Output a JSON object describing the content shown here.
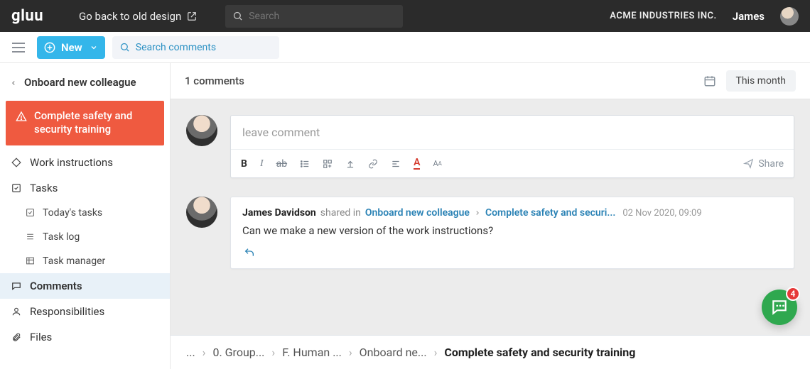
{
  "topbar": {
    "logo_text": "gluu",
    "back_link": "Go back to old design",
    "global_search_placeholder": "Search",
    "org_name": "ACME INDUSTRIES INC.",
    "user_name": "James"
  },
  "toolbar": {
    "new_label": "New",
    "comment_search_placeholder": "Search comments"
  },
  "sidebar": {
    "back_title": "Onboard new colleague",
    "alert_item": "Complete safety and security training",
    "items": [
      "Work instructions",
      "Tasks",
      "Comments",
      "Responsibilities",
      "Files"
    ],
    "task_subitems": [
      "Today's tasks",
      "Task log",
      "Task manager"
    ],
    "active_item": "Comments"
  },
  "header": {
    "comment_count": "1 comments",
    "range_label": "This month"
  },
  "compose": {
    "placeholder": "leave comment",
    "share_label": "Share"
  },
  "comment": {
    "author": "James Davidson",
    "shared_in_label": "shared in",
    "crumb1": "Onboard new colleague",
    "crumb2": "Complete safety and securi...",
    "timestamp": "02 Nov 2020, 09:09",
    "body": "Can we make a new version of the work instructions?"
  },
  "breadcrumb": {
    "root": "...",
    "l1": "0. Group...",
    "l2": "F. Human ...",
    "l3": "Onboard ne...",
    "l4": "Complete safety and security training"
  },
  "chat": {
    "badge_count": "4"
  }
}
